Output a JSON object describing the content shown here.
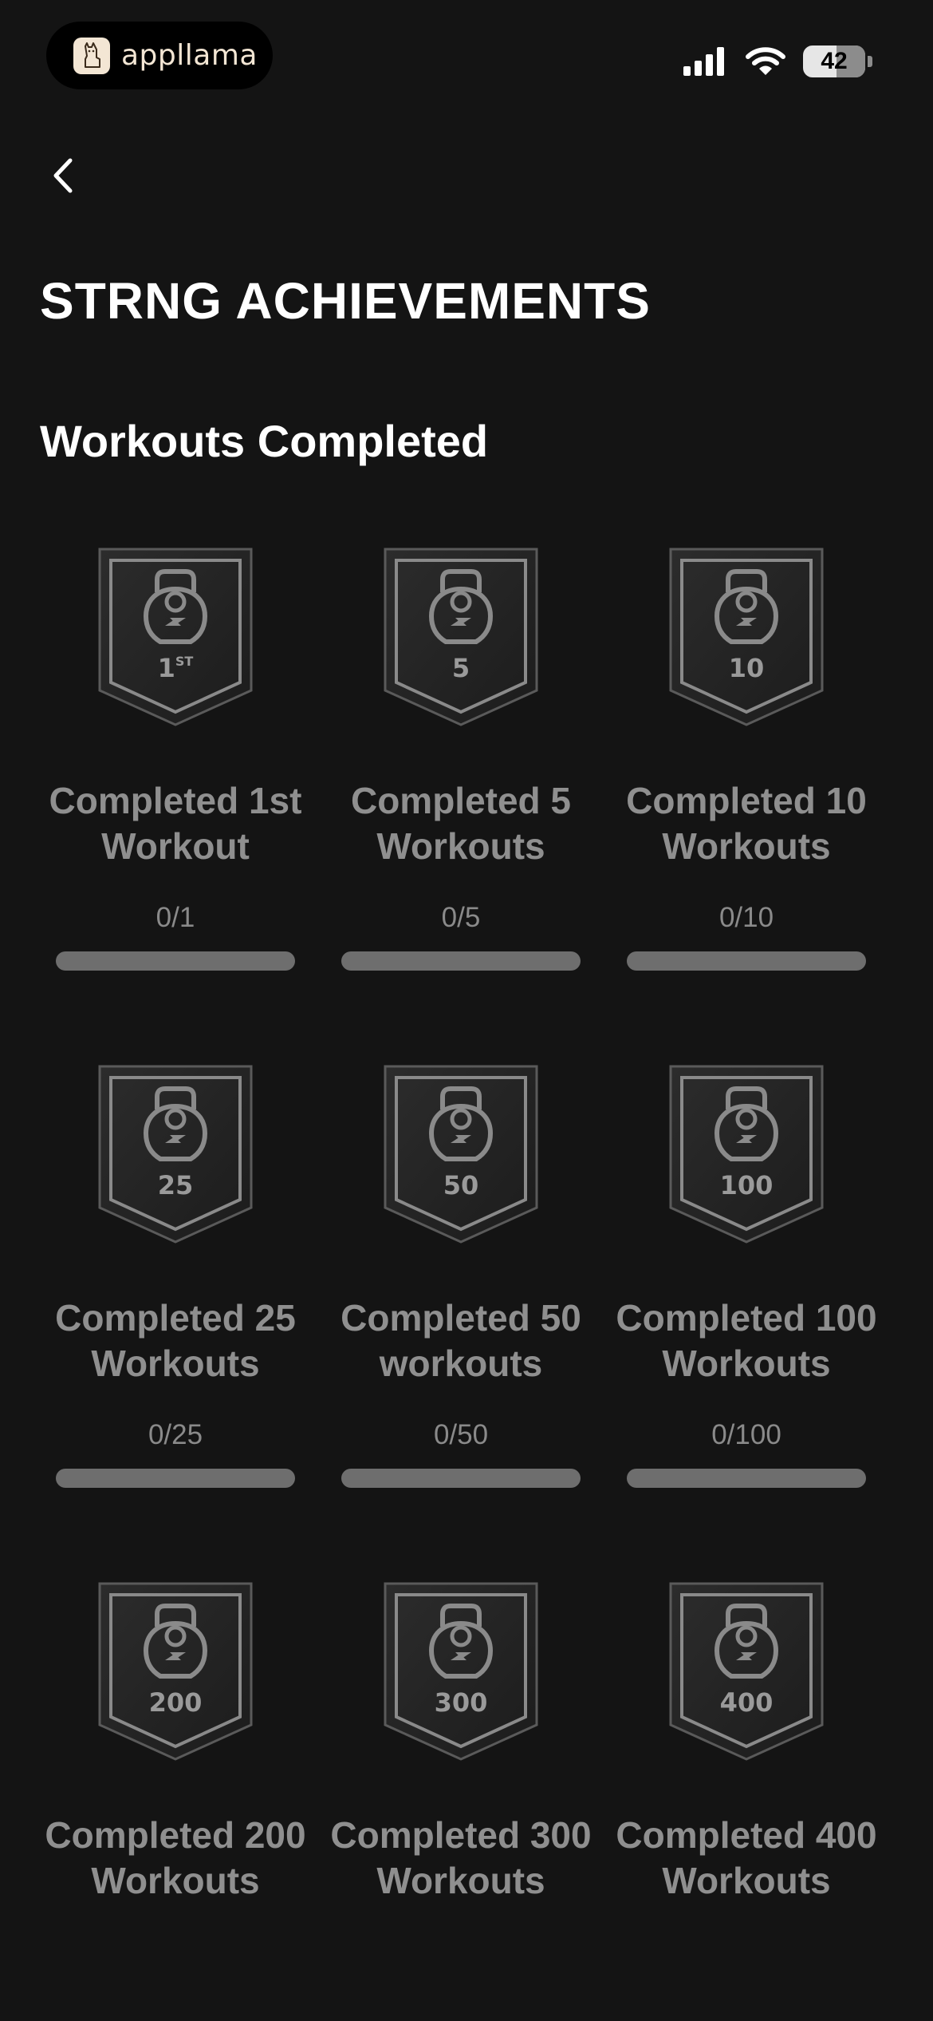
{
  "status_bar": {
    "app_name": "appllama",
    "battery_level": "42"
  },
  "header": {
    "back_icon": "chevron-left-icon",
    "title": "STRNG ACHIEVEMENTS"
  },
  "section": {
    "title": "Workouts Completed"
  },
  "achievements": [
    {
      "badge_text": "1",
      "badge_sup": "ST",
      "label": "Completed 1st Workout",
      "progress_text": "0/1",
      "current": 0,
      "target": 1
    },
    {
      "badge_text": "5",
      "badge_sup": "",
      "label": "Completed 5 Workouts",
      "progress_text": "0/5",
      "current": 0,
      "target": 5
    },
    {
      "badge_text": "10",
      "badge_sup": "",
      "label": "Completed 10 Workouts",
      "progress_text": "0/10",
      "current": 0,
      "target": 10
    },
    {
      "badge_text": "25",
      "badge_sup": "",
      "label": "Completed 25 Workouts",
      "progress_text": "0/25",
      "current": 0,
      "target": 25
    },
    {
      "badge_text": "50",
      "badge_sup": "",
      "label": "Completed 50 workouts",
      "progress_text": "0/50",
      "current": 0,
      "target": 50
    },
    {
      "badge_text": "100",
      "badge_sup": "",
      "label": "Completed 100 Workouts",
      "progress_text": "0/100",
      "current": 0,
      "target": 100
    },
    {
      "badge_text": "200",
      "badge_sup": "",
      "label": "Completed 200 Workouts",
      "progress_text": "",
      "current": 0,
      "target": 200
    },
    {
      "badge_text": "300",
      "badge_sup": "",
      "label": "Completed 300 Workouts",
      "progress_text": "",
      "current": 0,
      "target": 300
    },
    {
      "badge_text": "400",
      "badge_sup": "",
      "label": "Completed 400 Workouts",
      "progress_text": "",
      "current": 0,
      "target": 400
    }
  ],
  "colors": {
    "background": "#141414",
    "badge_fill": "#262626",
    "badge_stroke": "#7a7a7a",
    "label_text": "#8f8f8f",
    "progress_track": "#6e6e6e"
  }
}
